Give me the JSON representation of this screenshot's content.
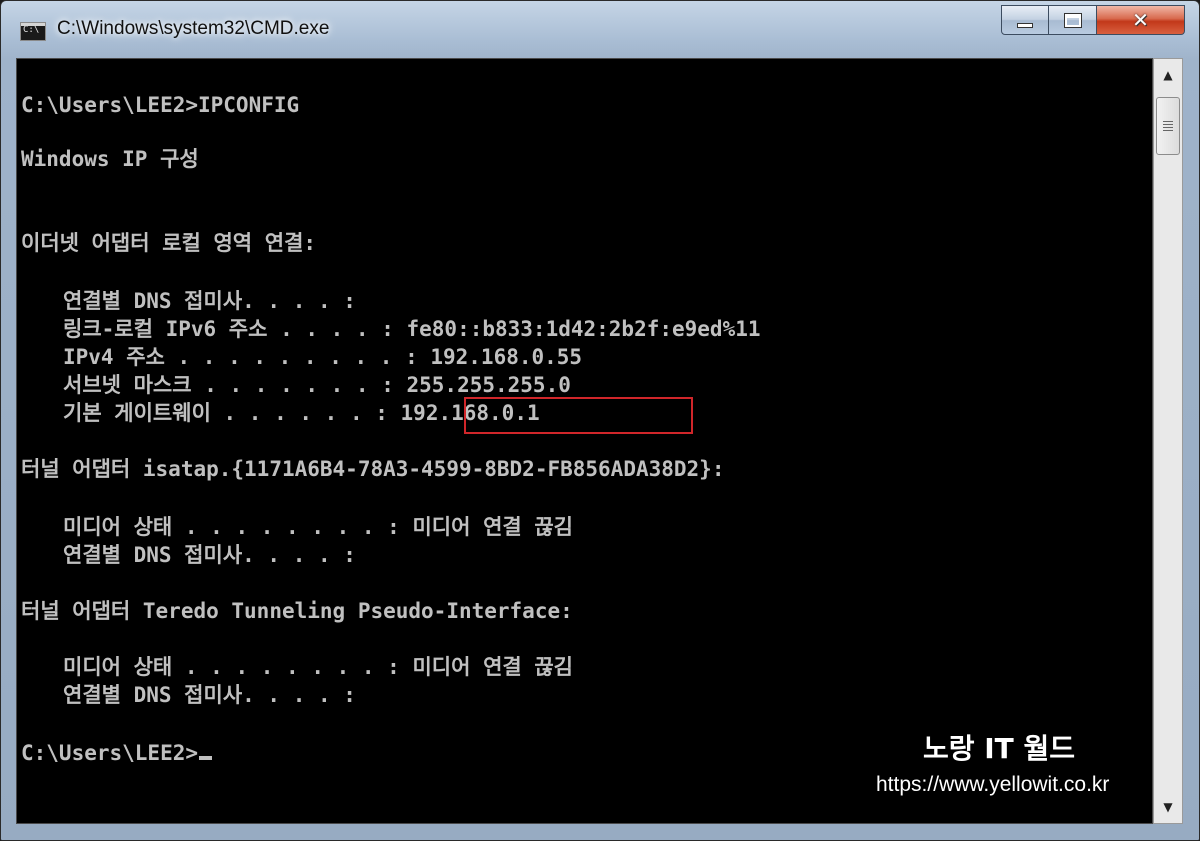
{
  "window": {
    "title": "C:\\Windows\\system32\\CMD.exe",
    "icon_label": "C:\\"
  },
  "console": {
    "lines": [
      "C:\\Users\\LEE2>IPCONFIG",
      "Windows IP 구성",
      "이더넷 어댑터 로컬 영역 연결:",
      "연결별 DNS 접미사. . . . :",
      "링크-로컬 IPv6 주소 . . . . : fe80::b833:1d42:2b2f:e9ed%11",
      "IPv4 주소 . . . . . . . . . : 192.168.0.55",
      "서브넷 마스크 . . . . . . . : 255.255.255.0",
      "기본 게이트웨이 . . . . . . : 192.168.0.1",
      "터널 어댑터 isatap.{1171A6B4-78A3-4599-8BD2-FB856ADA38D2}:",
      "미디어 상태 . . . . . . . . : 미디어 연결 끊김",
      "연결별 DNS 접미사. . . . :",
      "터널 어댑터 Teredo Tunneling Pseudo-Interface:",
      "미디어 상태 . . . . . . . . : 미디어 연결 끊김",
      "연결별 DNS 접미사. . . . :",
      "C:\\Users\\LEE2>"
    ]
  },
  "watermark": {
    "title": "노랑 IT 월드",
    "url": "https://www.yellowit.co.kr"
  },
  "scrollbar": {
    "up_icon": "up-arrow-icon",
    "down_icon": "down-arrow-icon"
  }
}
